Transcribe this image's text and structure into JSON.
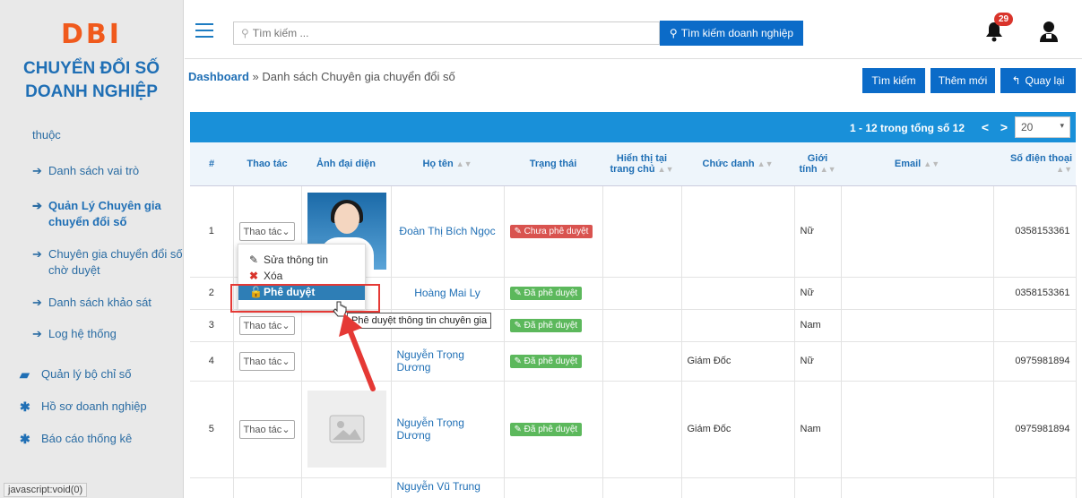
{
  "brand": {
    "logo": "DBI",
    "line1": "CHUYỂN ĐỔI SỐ",
    "line2": "DOANH NGHIỆP"
  },
  "sidebar": {
    "cut_text": "thuộc",
    "items": [
      {
        "label": "Danh sách vai trò",
        "icon": "arrow-right-icon"
      },
      {
        "label": "Quản Lý Chuyên gia chuyển đổi số",
        "icon": "arrow-right-icon",
        "active": true
      },
      {
        "label": "Chuyên gia chuyển đổi số chờ duyệt",
        "icon": "arrow-right-icon"
      },
      {
        "label": "Danh sách khảo sát",
        "icon": "arrow-right-icon"
      },
      {
        "label": "Log hệ thống",
        "icon": "arrow-right-icon"
      }
    ],
    "groups": [
      {
        "label": "Quản lý bộ chỉ số",
        "icon": "book-icon"
      },
      {
        "label": "Hồ sơ doanh nghiệp",
        "icon": "asterisk-icon"
      },
      {
        "label": "Báo cáo thống kê",
        "icon": "asterisk-icon"
      }
    ]
  },
  "status_bar": "javascript:void(0)",
  "topbar": {
    "search_placeholder": "Tìm kiếm ...",
    "search_button": "Tìm kiếm doanh nghiệp",
    "notification_count": "29"
  },
  "breadcrumb": {
    "home": "Dashboard",
    "separator": "»",
    "current": "Danh sách Chuyên gia chuyển đổi số"
  },
  "toolbar": {
    "search": "Tìm kiếm",
    "add": "Thêm mới",
    "back": "Quay lại"
  },
  "pager": {
    "info": "1 - 12 trong tổng số 12",
    "page_size": "20"
  },
  "table": {
    "headers": [
      "#",
      "Thao tác",
      "Ảnh đại diện",
      "Họ tên",
      "Trạng thái",
      "Hiển thị tại trang chủ",
      "Chức danh",
      "Giới tính",
      "Email",
      "Số điện thoại"
    ],
    "action_label": "Thao tác",
    "rows": [
      {
        "no": "1",
        "name": "Đoàn Thị Bích Ngọc",
        "status": "Chưa phê duyệt",
        "status_color": "#d9534f",
        "title": "",
        "gender": "Nữ",
        "phone": "0358153361"
      },
      {
        "no": "2",
        "name": "Hoàng Mai Ly",
        "status": "Đã phê duyệt",
        "status_color": "#5cb85c",
        "title": "",
        "gender": "Nữ",
        "phone": "0358153361"
      },
      {
        "no": "3",
        "name": "",
        "status": "Đã phê duyệt",
        "status_color": "#5cb85c",
        "title": "",
        "gender": "Nam",
        "phone": ""
      },
      {
        "no": "4",
        "name": "Nguyễn Trọng Dương",
        "status": "Đã phê duyệt",
        "status_color": "#5cb85c",
        "title": "Giám Đốc",
        "gender": "Nữ",
        "phone": "0975981894"
      },
      {
        "no": "5",
        "name": "Nguyễn Trọng Dương",
        "status": "Đã phê duyệt",
        "status_color": "#5cb85c",
        "title": "Giám Đốc",
        "gender": "Nam",
        "phone": "0975981894"
      },
      {
        "no": "",
        "name": "Nguyễn Vũ Trung",
        "status": "",
        "title": "",
        "gender": "",
        "phone": ""
      }
    ]
  },
  "dropdown": {
    "edit": "Sửa thông tin",
    "delete": "Xóa",
    "approve": "Phê duyệt"
  },
  "tooltip": "Phê duyệt thông tin chuyên gia"
}
